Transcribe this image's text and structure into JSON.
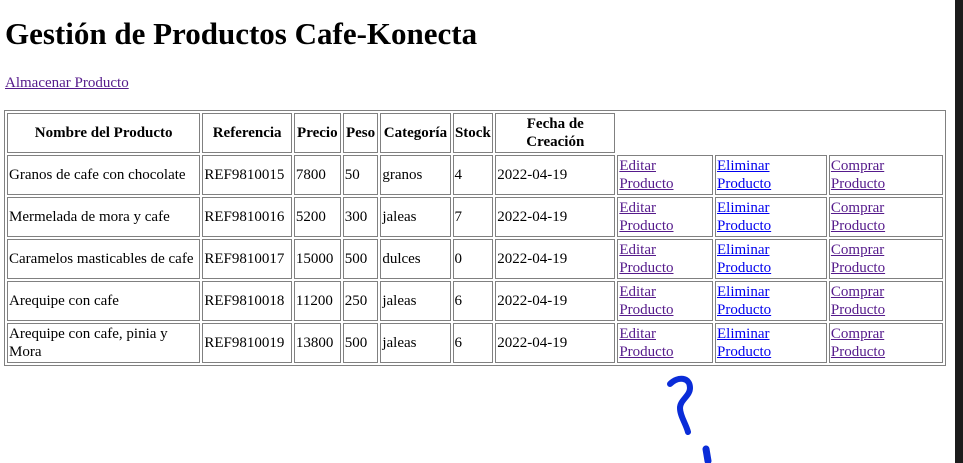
{
  "page": {
    "title": "Gestión de Productos Cafe-Konecta",
    "store_link": "Almacenar Producto"
  },
  "table": {
    "headers": [
      "Nombre del Producto",
      "Referencia",
      "Precio",
      "Peso",
      "Categoría",
      "Stock",
      "Fecha de Creación"
    ],
    "rows": [
      {
        "nombre": "Granos de cafe con chocolate",
        "referencia": "REF9810015",
        "precio": "7800",
        "peso": "50",
        "categoria": "granos",
        "stock": "4",
        "fecha": "2022-04-19"
      },
      {
        "nombre": "Mermelada de mora y cafe",
        "referencia": "REF9810016",
        "precio": "5200",
        "peso": "300",
        "categoria": "jaleas",
        "stock": "7",
        "fecha": "2022-04-19"
      },
      {
        "nombre": "Caramelos masticables de cafe",
        "referencia": "REF9810017",
        "precio": "15000",
        "peso": "500",
        "categoria": "dulces",
        "stock": "0",
        "fecha": "2022-04-19"
      },
      {
        "nombre": "Arequipe con cafe",
        "referencia": "REF9810018",
        "precio": "11200",
        "peso": "250",
        "categoria": "jaleas",
        "stock": "6",
        "fecha": "2022-04-19"
      },
      {
        "nombre": "Arequipe con cafe, pinia y Mora",
        "referencia": "REF9810019",
        "precio": "13800",
        "peso": "500",
        "categoria": "jaleas",
        "stock": "6",
        "fecha": "2022-04-19"
      }
    ],
    "actions": {
      "edit": "Editar Producto",
      "delete": "Eliminar Producto",
      "buy": "Comprar Producto"
    }
  },
  "colors": {
    "link_visited": "#551a8b",
    "link_unvisited": "#0000ee",
    "border": "#808080",
    "annotation_ink": "#0a2cd8"
  },
  "annotation": {
    "icon": "handwritten-question-mark-icon",
    "text": "?"
  }
}
